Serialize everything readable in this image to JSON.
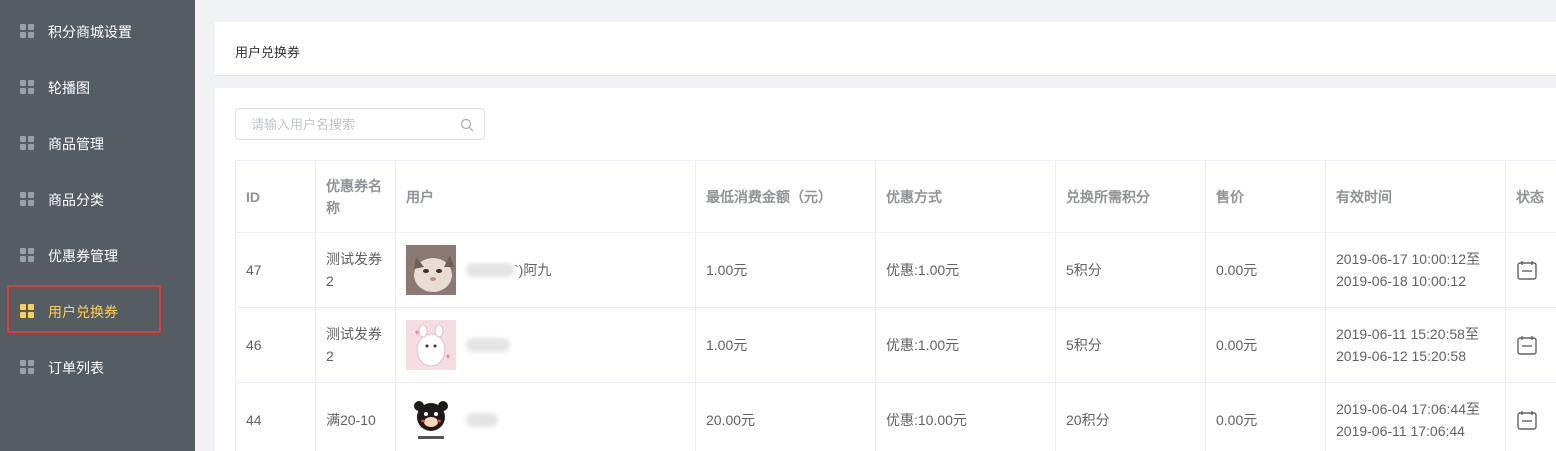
{
  "sidebar": {
    "items": [
      {
        "label": "积分商城设置",
        "active": false
      },
      {
        "label": "轮播图",
        "active": false
      },
      {
        "label": "商品管理",
        "active": false
      },
      {
        "label": "商品分类",
        "active": false
      },
      {
        "label": "优惠券管理",
        "active": false
      },
      {
        "label": "用户兑换券",
        "active": true
      },
      {
        "label": "订单列表",
        "active": false
      }
    ],
    "active_color": "#ffd04b",
    "bg_color": "#545c64"
  },
  "breadcrumb": {
    "title": "用户兑换券"
  },
  "search": {
    "placeholder": "请输入用户名搜索",
    "value": ""
  },
  "table": {
    "headers": {
      "id": "ID",
      "coupon_name": "优惠券名称",
      "user": "用户",
      "min_spend": "最低消费金额（元）",
      "discount": "优惠方式",
      "points": "兑换所需积分",
      "price": "售价",
      "valid_time": "有效时间",
      "status": "状态"
    },
    "rows": [
      {
        "id": "47",
        "coupon_name": "测试发券2",
        "user_name": "`)阿九",
        "min_spend": "1.00元",
        "discount": "优惠:1.00元",
        "points": "5积分",
        "price": "0.00元",
        "valid_from": "2019-06-17 10:00:12至",
        "valid_to": "2019-06-18 10:00:12",
        "status_icon": "calendar-icon"
      },
      {
        "id": "46",
        "coupon_name": "测试发券2",
        "user_name": "",
        "min_spend": "1.00元",
        "discount": "优惠:1.00元",
        "points": "5积分",
        "price": "0.00元",
        "valid_from": "2019-06-11 15:20:58至",
        "valid_to": "2019-06-12 15:20:58",
        "status_icon": "calendar-icon"
      },
      {
        "id": "44",
        "coupon_name": "满20-10",
        "user_name": "",
        "min_spend": "20.00元",
        "discount": "优惠:10.00元",
        "points": "20积分",
        "price": "0.00元",
        "valid_from": "2019-06-04 17:06:44至",
        "valid_to": "2019-06-11 17:06:44",
        "status_icon": "calendar-icon"
      }
    ]
  }
}
